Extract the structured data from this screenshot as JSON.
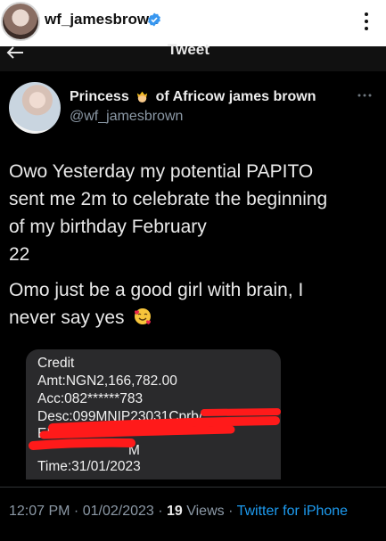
{
  "ig_header": {
    "username": "wf_jamesbrown"
  },
  "nav": {
    "title": "Tweet"
  },
  "author": {
    "name_part1": "Princess",
    "name_part2": "of Africow james brown",
    "handle": "@wf_jamesbrown"
  },
  "tweet": {
    "paragraph1_line1": "Owo Yesterday my potential PAPITO",
    "paragraph1_line2": "sent me 2m to celebrate the beginning",
    "paragraph1_line3": "of my birthday February",
    "paragraph1_line4": "22",
    "paragraph2_line1": "Omo just be a good girl with brain, I",
    "paragraph2_line2": "never say yes"
  },
  "media": {
    "line1": "Credit",
    "line2": "Amt:NGN2,166,782.00",
    "line3": "Acc:082******783",
    "line4": "Desc:099MNIP23031Cprb/",
    "line5_fragment": "EI",
    "line6_fragment": "M",
    "line7": "Time:31/01/2023"
  },
  "meta": {
    "time": "12:07 PM",
    "sep1": " · ",
    "date": "01/02/2023",
    "sep2": " · ",
    "views_count": "19",
    "views_label": " Views",
    "sep3": " · ",
    "source": "Twitter for iPhone"
  },
  "colors": {
    "verified": "#3897f0",
    "link": "#1d9bf0",
    "redaction": "#ff1a1a",
    "muted": "#8b98a5"
  },
  "icons": [
    "verified-badge-icon",
    "more-vertical-icon",
    "back-arrow-icon",
    "more-horizontal-icon",
    "princess-emoji-icon",
    "smiling-hearts-emoji-icon"
  ]
}
